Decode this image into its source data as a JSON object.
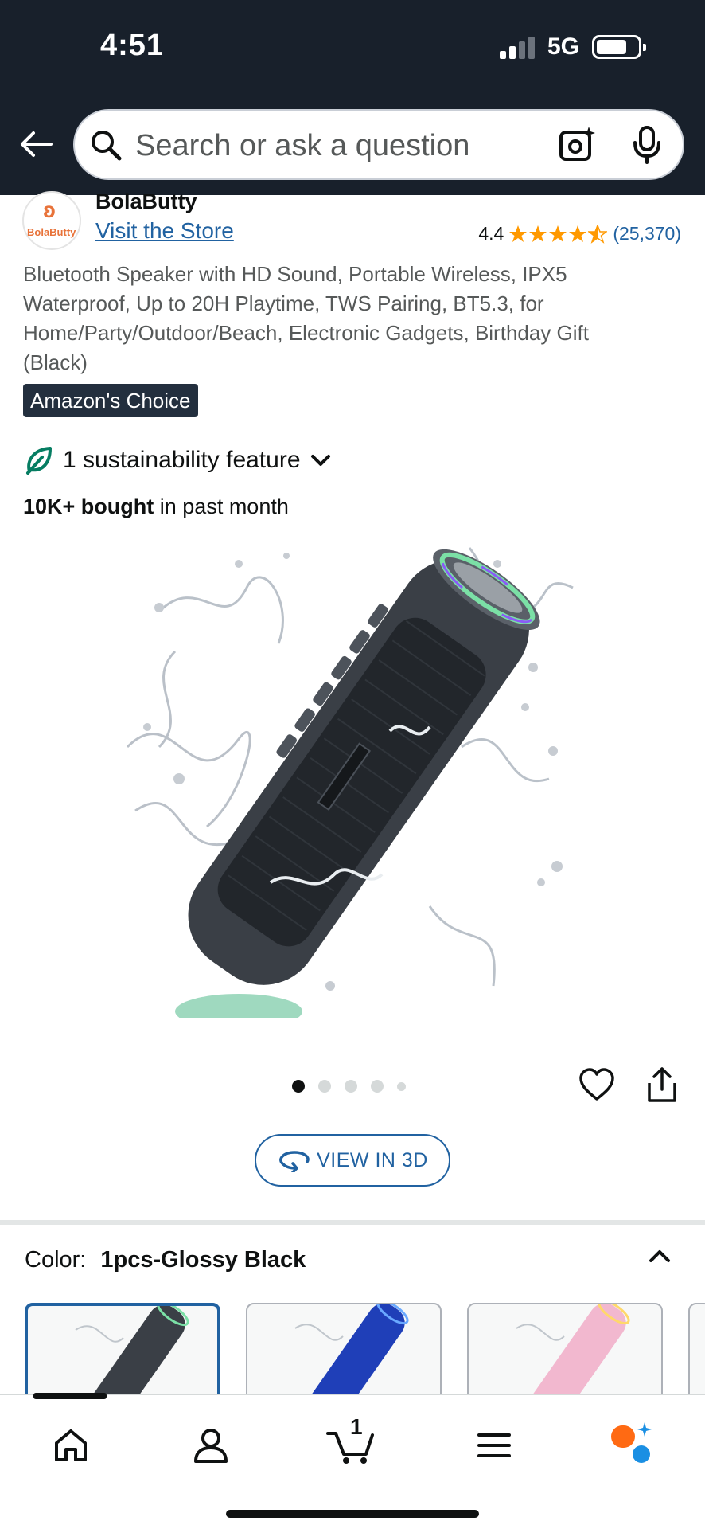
{
  "status_bar": {
    "time": "4:51",
    "network": "5G"
  },
  "search": {
    "placeholder": "Search or ask a question"
  },
  "brand": {
    "name": "BolaButty",
    "logo_text": "BolaButty",
    "store_link": "Visit the Store"
  },
  "rating": {
    "value": "4.4",
    "stars": 4.4,
    "count": "(25,370)"
  },
  "product": {
    "title": "Bluetooth Speaker with HD Sound, Portable Wireless, IPX5 Waterproof, Up to 20H Playtime, TWS Pairing, BT5.3, for Home/Party/Outdoor/Beach, Electronic Gadgets, Birthday Gift (Black)",
    "badge": "Amazon's Choice",
    "sustainability": "1 sustainability feature",
    "bought_bold": "10K+ bought",
    "bought_rest": " in past month",
    "image_count": 5,
    "active_image": 1
  },
  "view3d": {
    "label": "VIEW IN 3D"
  },
  "color": {
    "label": "Color:",
    "selected": "1pcs-Glossy Black"
  },
  "swatches": [
    "black",
    "blue",
    "pink"
  ],
  "cart": {
    "count": "1"
  },
  "colors": {
    "header_bg": "#18202b",
    "link": "#2162a1",
    "star": "#ff9900",
    "badge_bg": "#232f3e"
  },
  "icons": [
    "back-arrow-icon",
    "search-icon",
    "camera-lens-icon",
    "microphone-icon",
    "leaf-icon",
    "chevron-down-icon",
    "heart-icon",
    "share-icon",
    "rotate-3d-icon",
    "chevron-up-icon",
    "home-icon",
    "account-icon",
    "cart-icon",
    "menu-icon",
    "rufus-icon"
  ]
}
